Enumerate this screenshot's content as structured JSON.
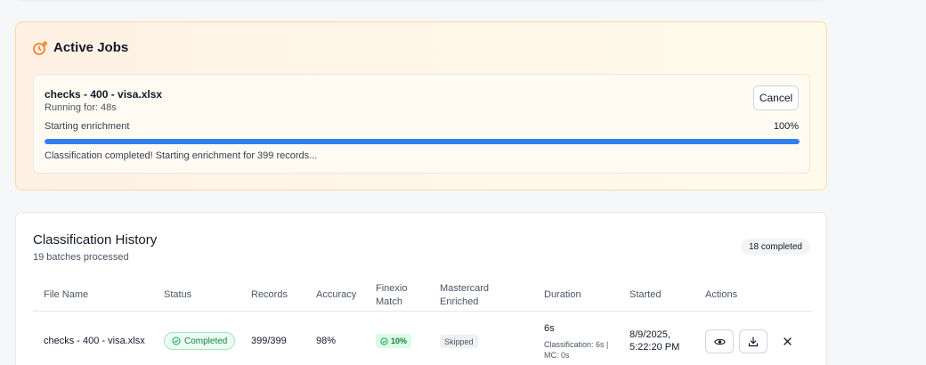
{
  "active_jobs": {
    "title": "Active Jobs",
    "job": {
      "name": "checks - 400 - visa.xlsx",
      "running_for": "Running for: 48s",
      "cancel_label": "Cancel",
      "stage": "Starting enrichment",
      "percent_label": "100%",
      "progress_fraction": 1.0,
      "message": "Classification completed! Starting enrichment for 399 records..."
    }
  },
  "history": {
    "title": "Classification History",
    "subtitle": "19 batches processed",
    "completed_badge": "18 completed",
    "columns": {
      "file_name": "File Name",
      "status": "Status",
      "records": "Records",
      "accuracy": "Accuracy",
      "finexio_l1": "Finexio",
      "finexio_l2": "Match",
      "mastercard_l1": "Mastercard",
      "mastercard_l2": "Enriched",
      "duration": "Duration",
      "started": "Started",
      "actions": "Actions"
    },
    "rows": [
      {
        "file_name": "checks - 400 - visa.xlsx",
        "status": "Completed",
        "records": "399/399",
        "accuracy": "98%",
        "finexio_match": "10%",
        "mastercard": "Skipped",
        "duration": "6s",
        "duration_detail": "Classification: 6s | MC: 0s",
        "started": "8/9/2025, 5:22:20 PM"
      }
    ]
  },
  "colors": {
    "accent_orange": "#f97316",
    "progress_blue": "#2f80ed",
    "success_green": "#15803d"
  },
  "icons": [
    "clock-icon",
    "check-circle-icon",
    "eye-icon",
    "download-icon",
    "close-icon"
  ]
}
